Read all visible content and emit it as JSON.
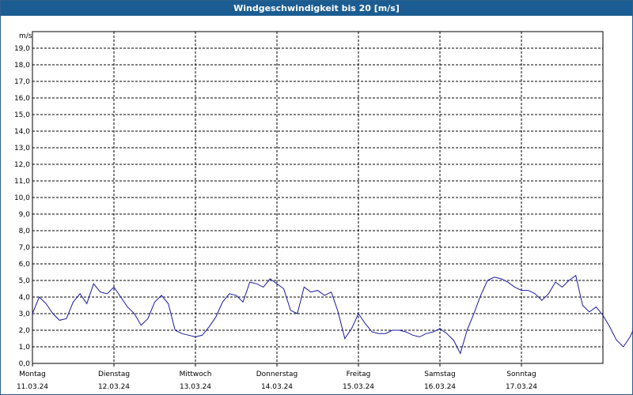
{
  "chart_data": {
    "type": "line",
    "title": "Windgeschwindigkeit bis 20 [m/s]",
    "ylabel": "m/s",
    "ylim": [
      0,
      20
    ],
    "grid": true,
    "yticks": [
      "0,0",
      "1,0",
      "2,0",
      "3,0",
      "4,0",
      "5,0",
      "6,0",
      "7,0",
      "8,0",
      "9,0",
      "10,0",
      "11,0",
      "12,0",
      "13,0",
      "14,0",
      "15,0",
      "16,0",
      "17,0",
      "18,0",
      "19,0"
    ],
    "days": [
      {
        "name": "Montag",
        "date": "11.03.24"
      },
      {
        "name": "Dienstag",
        "date": "12.03.24"
      },
      {
        "name": "Mittwoch",
        "date": "13.03.24"
      },
      {
        "name": "Donnerstag",
        "date": "14.03.24"
      },
      {
        "name": "Freitag",
        "date": "15.03.24"
      },
      {
        "name": "Samstag",
        "date": "16.03.24"
      },
      {
        "name": "Sonntag",
        "date": "17.03.24"
      }
    ],
    "series": [
      {
        "color": "#1a1aa0",
        "x_hours": [
          0,
          2,
          4,
          6,
          8,
          10,
          12,
          14,
          16,
          18,
          20,
          22,
          24,
          26,
          28,
          30,
          32,
          34,
          36,
          38,
          40,
          42,
          44,
          46,
          48,
          50,
          52,
          54,
          56,
          58,
          60,
          62,
          64,
          66,
          68,
          70,
          72,
          74,
          76,
          78,
          80,
          82,
          84,
          86,
          88,
          90,
          92,
          94,
          96,
          98,
          100,
          102,
          104,
          106,
          108,
          110,
          112,
          114,
          116,
          118,
          120,
          122,
          124,
          126,
          128,
          130,
          132,
          134,
          136,
          138,
          140,
          142,
          144,
          146,
          148,
          150,
          152,
          154,
          156,
          158,
          160,
          162,
          164,
          166,
          168,
          170,
          172,
          174,
          176,
          178,
          180,
          182,
          184,
          186,
          188,
          190,
          192,
          194,
          196,
          198,
          200,
          202,
          204,
          206,
          208,
          210,
          212,
          214,
          216,
          218,
          220,
          222,
          224,
          226,
          228,
          230,
          232,
          234,
          236,
          238,
          240,
          242,
          244,
          246,
          248,
          250,
          252,
          254,
          256,
          258,
          260,
          262,
          264,
          266,
          268,
          270,
          272,
          274,
          276,
          278,
          280,
          282,
          284,
          286,
          288,
          290,
          292,
          294,
          296,
          298,
          300,
          302,
          304,
          306,
          308,
          310,
          312,
          314,
          316,
          318,
          320,
          322,
          324,
          326,
          328,
          330,
          332,
          334,
          336,
          338,
          340,
          342,
          344,
          346,
          348,
          350,
          352,
          354,
          356,
          358,
          360,
          362,
          364,
          366,
          368,
          370,
          372,
          374,
          376,
          378,
          380,
          382,
          384,
          386,
          388,
          390,
          392,
          394,
          396,
          398,
          400,
          402,
          404,
          406,
          408,
          410,
          412,
          414,
          416,
          418,
          420,
          422,
          424,
          426,
          428,
          430,
          432,
          434,
          436,
          438,
          440,
          442,
          444,
          446,
          448,
          450,
          452,
          454,
          456,
          458,
          460,
          462,
          464,
          466,
          468,
          470,
          472,
          474,
          476,
          478,
          480,
          482,
          484,
          486,
          488,
          490,
          492,
          494,
          496,
          498,
          500,
          502,
          504,
          506,
          508,
          510,
          512,
          514,
          516,
          518,
          520,
          522,
          524,
          526,
          528,
          530,
          532,
          534,
          536,
          538,
          540,
          542,
          544,
          546,
          548,
          550,
          552,
          554,
          556,
          558,
          560,
          562,
          564,
          566,
          568,
          570,
          572,
          574,
          576,
          578,
          580,
          582,
          584,
          586,
          588,
          590,
          592,
          594,
          596,
          598,
          600,
          602,
          604,
          606,
          608,
          610,
          612,
          614,
          616,
          618,
          620,
          622,
          624,
          626,
          628,
          630,
          632,
          634,
          636,
          638,
          640,
          642,
          644,
          646,
          648,
          650,
          652,
          654,
          656,
          658,
          660,
          662,
          664,
          666,
          668
        ],
        "values": [
          3.0,
          4.0,
          3.6,
          3.0,
          2.6,
          2.7,
          3.7,
          4.2,
          3.6,
          4.8,
          4.3,
          4.2,
          4.6,
          4.0,
          3.4,
          3.0,
          2.3,
          2.7,
          3.7,
          4.1,
          3.6,
          2.0,
          1.8,
          1.7,
          1.6,
          1.7,
          2.2,
          2.8,
          3.7,
          4.2,
          4.1,
          3.7,
          4.9,
          4.8,
          4.6,
          5.1,
          4.8,
          4.5,
          3.2,
          3.0,
          4.6,
          4.3,
          4.4,
          4.1,
          4.3,
          3.1,
          1.5,
          2.1,
          3.0,
          2.4,
          1.9,
          1.8,
          1.8,
          2.0,
          2.0,
          1.9,
          1.7,
          1.6,
          1.8,
          1.9,
          2.1,
          1.8,
          1.4,
          0.6,
          2.0,
          3.0,
          4.1,
          5.0,
          5.2,
          5.1,
          4.9,
          4.6,
          4.4,
          4.4,
          4.2,
          3.8,
          4.2,
          4.9,
          4.6,
          5.0,
          5.3,
          3.5,
          3.1,
          3.4,
          2.9,
          2.2,
          1.4,
          1.0,
          1.6,
          2.5,
          3.0,
          2.5,
          3.0,
          3.7,
          3.2,
          2.7,
          2.1,
          1.6,
          1.6,
          1.4,
          1.6,
          2.1,
          2.0,
          2.3,
          2.8,
          2.9,
          2.8,
          2.7,
          2.6,
          2.8,
          3.0,
          2.9,
          2.2,
          2.5,
          2.6,
          2.5,
          1.8,
          1.5,
          1.7,
          2.2,
          2.5,
          3.0,
          2.8,
          2.6,
          2.0,
          2.4,
          2.9,
          3.9,
          4.4,
          4.5,
          4.6,
          4.7,
          4.5,
          4.2,
          4.4,
          4.8,
          5.4,
          5.6,
          4.2,
          5.3,
          6.0,
          6.6,
          5.8,
          4.0,
          4.6,
          5.9,
          3.8,
          3.4,
          3.0,
          2.9,
          3.0,
          3.2,
          2.9,
          3.3,
          4.1,
          3.9,
          3.6,
          3.8,
          3.3,
          4.6,
          4.7,
          5.0,
          4.9,
          4.8,
          4.6,
          4.1,
          4.4,
          4.4,
          4.3,
          4.2,
          3.0,
          2.9,
          3.0,
          3.4,
          3.1,
          2.9,
          2.7,
          2.4,
          2.3,
          1.9,
          1.7,
          1.6,
          1.5,
          1.0,
          0.7,
          1.1,
          2.8,
          2.4,
          1.5,
          1.4,
          1.1,
          1.6,
          1.9,
          1.2,
          1.6,
          1.4,
          2.0,
          2.3,
          2.5,
          2.2,
          2.3,
          2.5,
          2.1,
          2.0,
          2.4,
          2.7,
          3.0,
          3.1,
          3.0,
          2.8,
          2.4,
          2.1,
          1.9,
          1.8,
          1.7,
          1.9,
          1.9,
          1.6,
          1.4
        ]
      }
    ]
  }
}
